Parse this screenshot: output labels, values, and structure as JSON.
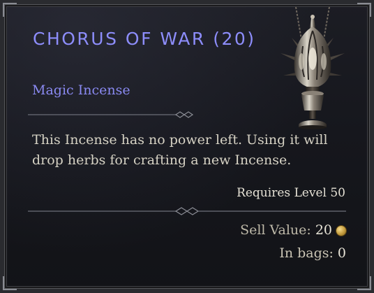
{
  "item": {
    "name": "Chorus of War (20)",
    "type": "Magic Incense",
    "description": "This Incense has no power left. Using it will drop herbs for crafting a new Incense.",
    "requirement": "Requires Level 50",
    "sell_label": "Sell Value:",
    "sell_value": "20",
    "bags_label": "In bags:",
    "bags_value": "0",
    "icon": "incense-censer-icon",
    "currency_icon": "gold-coin-icon"
  },
  "colors": {
    "title": "#8d8dfb",
    "type": "#8a8af2",
    "text": "#d6d2c4",
    "background": "#16171d"
  }
}
